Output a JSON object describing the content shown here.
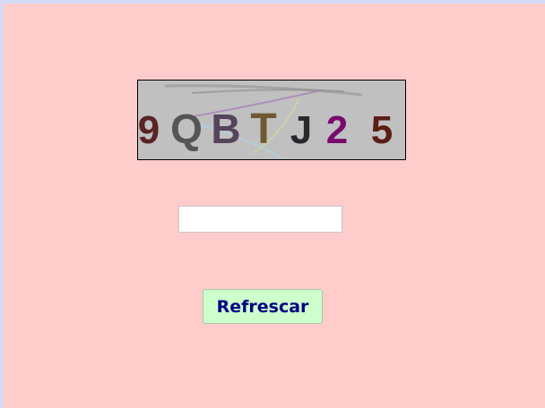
{
  "captcha": {
    "characters": [
      {
        "char": "9",
        "color": "#5a2323"
      },
      {
        "char": "Q",
        "color": "#555555"
      },
      {
        "char": "B",
        "color": "#55455a"
      },
      {
        "char": "T",
        "color": "#6e5a32"
      },
      {
        "char": "J",
        "color": "#28282d"
      },
      {
        "char": "2",
        "color": "#780a6e"
      },
      {
        "char": "5",
        "color": "#5a1e14"
      }
    ],
    "background_color": "#c0c0c0"
  },
  "input": {
    "value": "",
    "placeholder": ""
  },
  "refresh_button": {
    "label": "Refrescar",
    "background_color": "#ccffcc",
    "text_color": "#000080"
  },
  "colors": {
    "page_background": "#ffcccc",
    "frame_border": "#d4dcf5"
  }
}
